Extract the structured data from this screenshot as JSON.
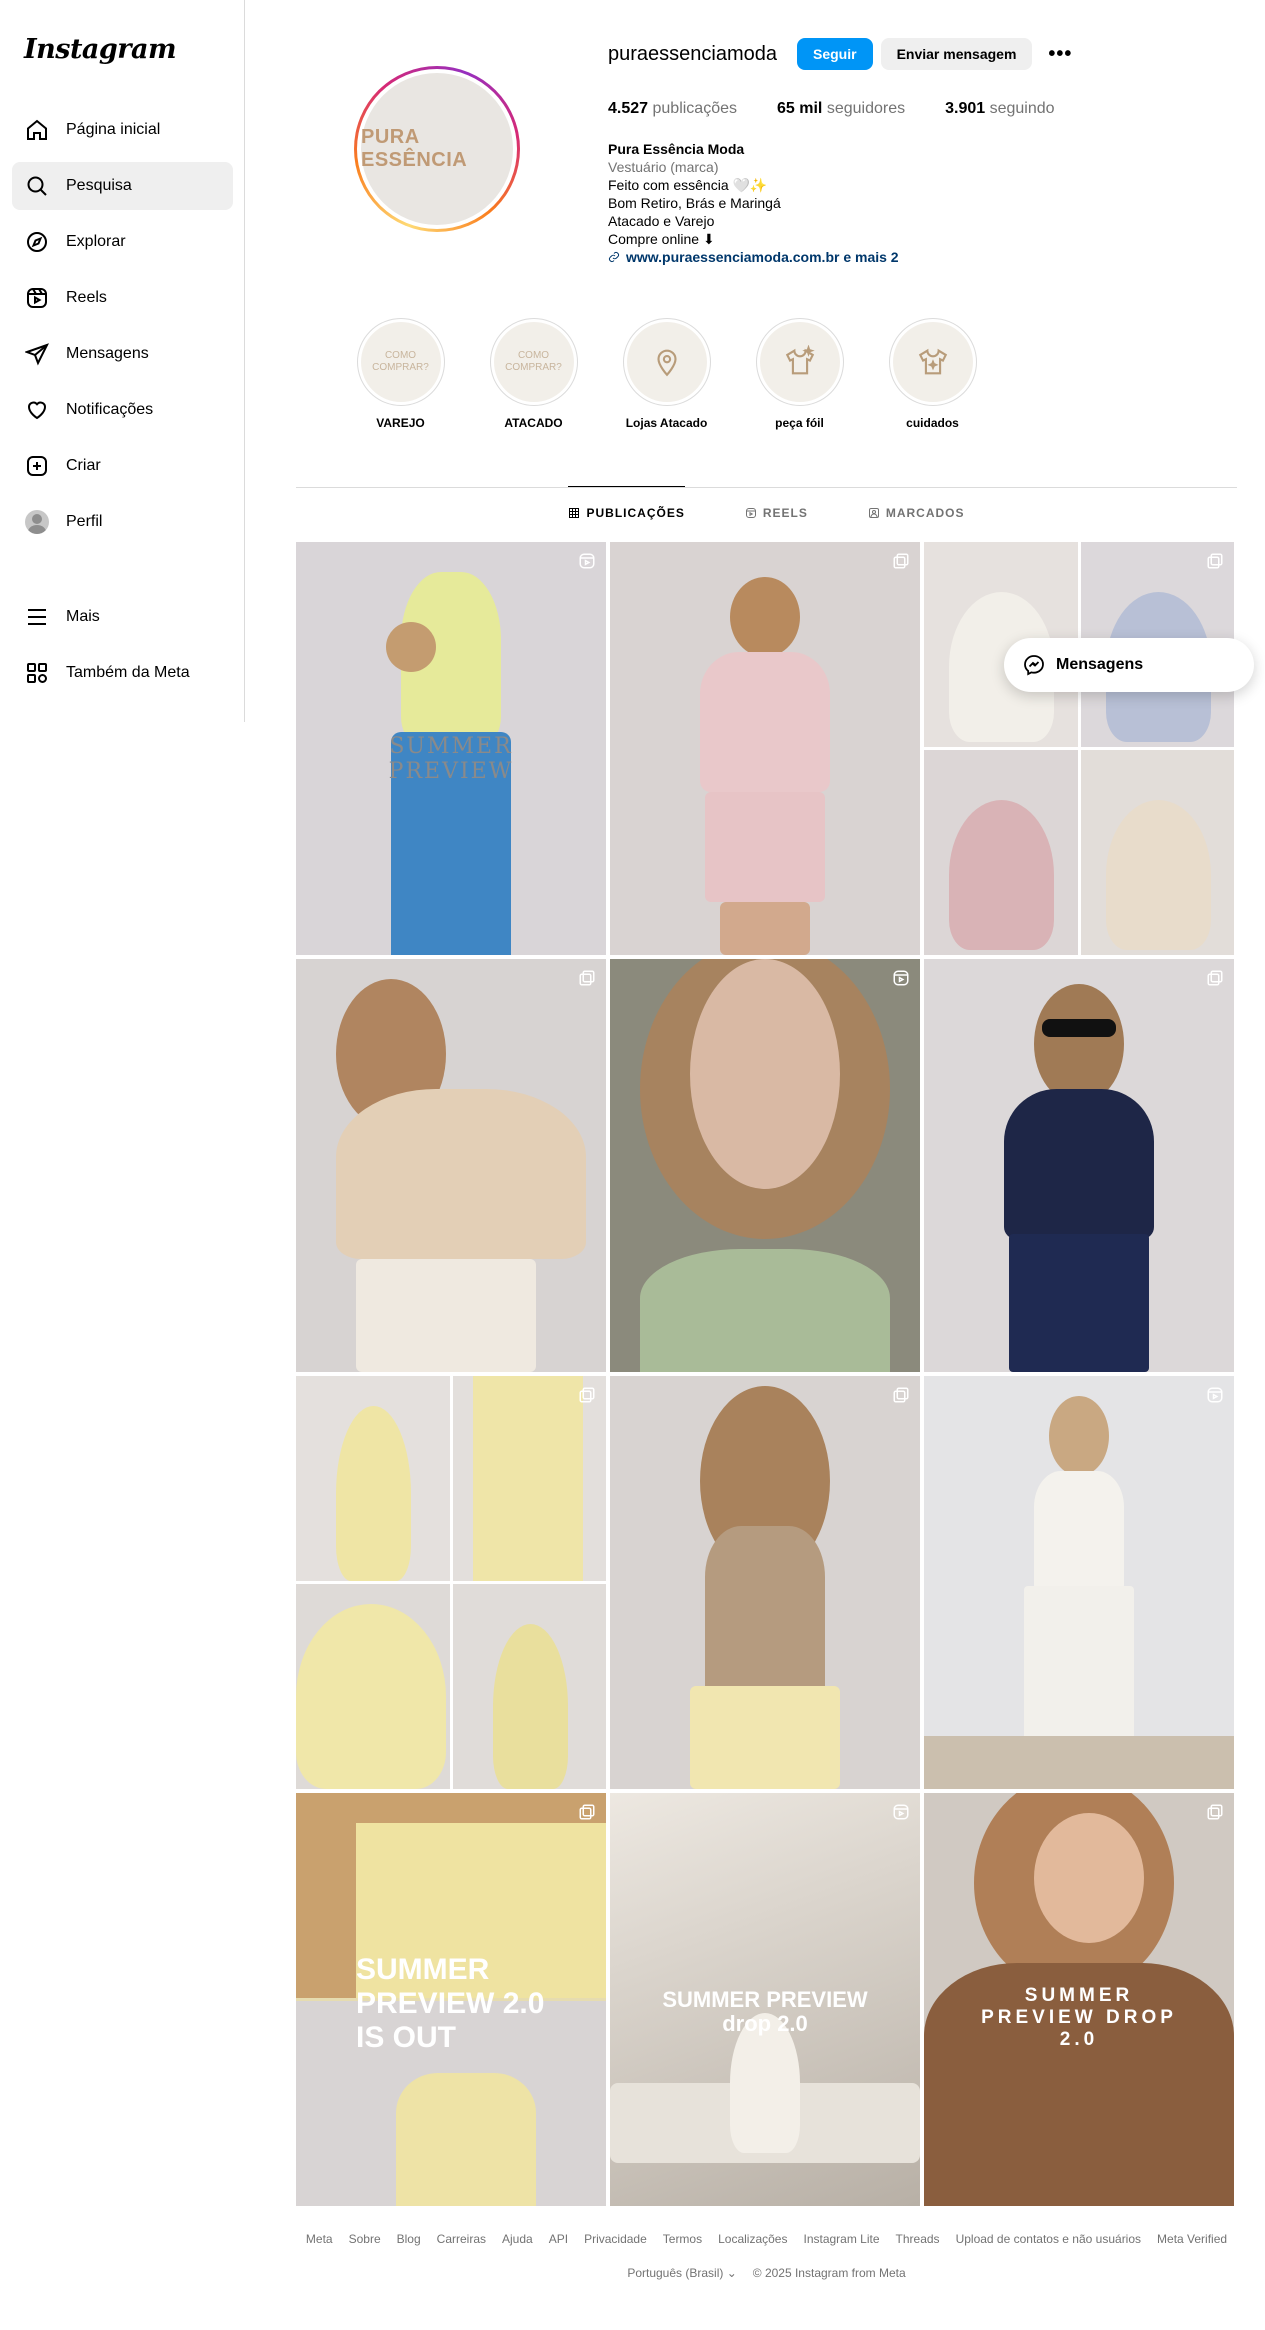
{
  "app": {
    "logo": "Instagram"
  },
  "sidebar": {
    "items": [
      {
        "label": "Página inicial",
        "icon": "home-icon"
      },
      {
        "label": "Pesquisa",
        "icon": "search-icon",
        "active": true
      },
      {
        "label": "Explorar",
        "icon": "compass-icon"
      },
      {
        "label": "Reels",
        "icon": "reels-icon"
      },
      {
        "label": "Mensagens",
        "icon": "send-icon"
      },
      {
        "label": "Notificações",
        "icon": "heart-icon"
      },
      {
        "label": "Criar",
        "icon": "plus-square-icon"
      },
      {
        "label": "Perfil",
        "icon": "avatar"
      }
    ],
    "bottom": [
      {
        "label": "Mais",
        "icon": "menu-icon"
      },
      {
        "label": "Também da Meta",
        "icon": "meta-grid-icon"
      }
    ]
  },
  "profile": {
    "username": "puraessenciamoda",
    "follow_label": "Seguir",
    "message_label": "Enviar mensagem",
    "more_label": "•••",
    "pic_text": "PURA ESSÊNCIA",
    "stats": {
      "posts_value": "4.527",
      "posts_label": "publicações",
      "followers_value": "65 mil",
      "followers_label": "seguidores",
      "following_value": "3.901",
      "following_label": "seguindo"
    },
    "bio": {
      "name": "Pura Essência Moda",
      "category": "Vestuário (marca)",
      "lines": [
        "Feito com essência 🤍✨",
        "Bom Retiro, Brás e Maringá",
        "Atacado e Varejo",
        "Compre online ⬇"
      ],
      "link": "www.puraessenciamoda.com.br e mais 2"
    }
  },
  "highlights": [
    {
      "label": "VAREJO",
      "inner_text": "COMO COMPRAR?",
      "icon": null
    },
    {
      "label": "ATACADO",
      "inner_text": "COMO COMPRAR?",
      "icon": null
    },
    {
      "label": "Lojas Atacado",
      "inner_text": "",
      "icon": "location-pin-icon"
    },
    {
      "label": "peça fóil",
      "inner_text": "",
      "icon": "shirt-icon"
    },
    {
      "label": "cuidados",
      "inner_text": "",
      "icon": "shirt-icon"
    }
  ],
  "tabs": [
    {
      "label": "PUBLICAÇÕES",
      "icon": "grid-icon",
      "active": true
    },
    {
      "label": "REELS",
      "icon": "reels-icon"
    },
    {
      "label": "MARCADOS",
      "icon": "tagged-icon"
    }
  ],
  "posts": [
    {
      "type": "reel",
      "overlay": "SUMMER PREVIEW",
      "bg": "#d8d4d8",
      "colors": [
        "#e6ea9a",
        "#3f86c4"
      ]
    },
    {
      "type": "carousel",
      "overlay": "",
      "bg": "#d9d3d2",
      "colors": [
        "#e9c8ca",
        "#e7c4c6"
      ]
    },
    {
      "type": "carousel",
      "overlay": "",
      "bg": "#e6e1de",
      "collage": [
        "#f2efe9",
        "#b8c0d6",
        "#d9b3b6",
        "#e8dccb"
      ]
    },
    {
      "type": "carousel",
      "overlay": "",
      "bg": "#d7d3d2",
      "colors": [
        "#e3cfb6",
        "#efe9e0"
      ]
    },
    {
      "type": "reel",
      "overlay": "",
      "bg": "#8b8a7c",
      "colors": [
        "#d9b9a4",
        "#a9bb98"
      ]
    },
    {
      "type": "carousel",
      "overlay": "",
      "bg": "#dcd8d9",
      "colors": [
        "#1e2647",
        "#1f2a52"
      ]
    },
    {
      "type": "carousel",
      "overlay": "",
      "bg": "#e4e0dd",
      "collage": [
        "#efe5a5",
        "#efe5a8",
        "#f0e7a9",
        "#e9df9d"
      ]
    },
    {
      "type": "carousel",
      "overlay": "",
      "bg": "#d8d3d1",
      "colors": [
        "#b59b7f",
        "#f1e6b0"
      ]
    },
    {
      "type": "reel",
      "overlay": "",
      "bg": "#e4e4e6",
      "colors": [
        "#f4f2ed",
        "#f2f0eb"
      ]
    },
    {
      "type": "carousel",
      "overlay": "SUMMER PREVIEW 2.0 IS OUT",
      "bg": "#e6dcb0",
      "colors": [
        "#efe3a1",
        "#eee3a6"
      ]
    },
    {
      "type": "reel",
      "overlay": "SUMMER PREVIEW drop 2.0",
      "bg": "#cdc7bf",
      "colors": [
        "#f3efe8",
        "#efe9df"
      ]
    },
    {
      "type": "carousel",
      "overlay": "SUMMER PREVIEW DROP 2.0",
      "bg": "#d0c9c2",
      "colors": [
        "#8a5e3e",
        "#7a5236"
      ]
    }
  ],
  "floating_messages": {
    "label": "Mensagens"
  },
  "footer": {
    "links": [
      "Meta",
      "Sobre",
      "Blog",
      "Carreiras",
      "Ajuda",
      "API",
      "Privacidade",
      "Termos",
      "Localizações",
      "Instagram Lite",
      "Threads",
      "Upload de contatos e não usuários",
      "Meta Verified"
    ],
    "language": "Português (Brasil) ⌄",
    "copyright": "© 2025 Instagram from Meta"
  }
}
